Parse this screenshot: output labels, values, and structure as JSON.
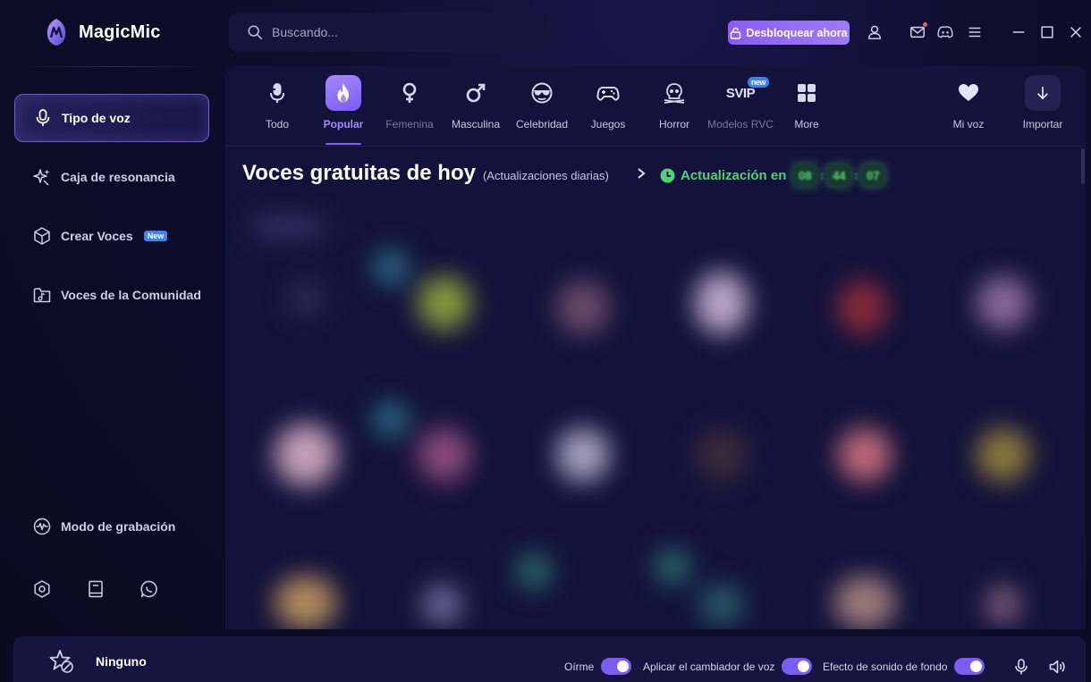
{
  "app": {
    "title": "MagicMic"
  },
  "search": {
    "placeholder": "Buscando..."
  },
  "header": {
    "unlock_label": "Desbloquear ahora",
    "icons": [
      "user-icon",
      "mail-icon",
      "discord-icon",
      "menu-icon",
      "minimize-icon",
      "maximize-icon",
      "close-icon"
    ]
  },
  "sidebar": {
    "items": [
      {
        "label": "Tipo de voz",
        "icon": "microphone-icon",
        "active": true
      },
      {
        "label": "Caja de resonancia",
        "icon": "sparkle-icon"
      },
      {
        "label": "Crear Voces",
        "icon": "cube-icon",
        "badge": "New"
      },
      {
        "label": "Voces de la Comunidad",
        "icon": "music-folder-icon"
      }
    ],
    "recording_mode": "Modo de grabación",
    "bottom_icons": [
      "settings-icon",
      "book-icon",
      "chat-icon"
    ]
  },
  "categories": [
    {
      "label": "Todo",
      "icon": "microphone-icon"
    },
    {
      "label": "Popular",
      "icon": "fire-icon",
      "active": true
    },
    {
      "label": "Femenina",
      "icon": "female-icon"
    },
    {
      "label": "Masculina",
      "icon": "male-icon"
    },
    {
      "label": "Celebridad",
      "icon": "sunglasses-icon"
    },
    {
      "label": "Juegos",
      "icon": "gamepad-icon"
    },
    {
      "label": "Horror",
      "icon": "skull-icon"
    },
    {
      "label": "Modelos RVC",
      "icon": "svip-icon",
      "text": "SVIP",
      "badge": "new"
    },
    {
      "label": "More",
      "icon": "grid-icon"
    },
    {
      "label": "Mi voz",
      "icon": "heart-icon"
    },
    {
      "label": "Importar",
      "icon": "download-icon"
    }
  ],
  "section": {
    "title": "Voces gratuitas de hoy",
    "subtitle": "(Actualizaciones diarias)",
    "update_label": "Actualización en",
    "timer": [
      "08",
      "44",
      "07"
    ]
  },
  "footer": {
    "current_voice": "Ninguno",
    "toggles": [
      {
        "label": "Oírme",
        "on": true
      },
      {
        "label": "Aplicar el cambiador de voz",
        "on": true
      },
      {
        "label": "Efecto de sonido de fondo",
        "on": true
      }
    ]
  },
  "colors": {
    "accent": "#8b5cf6",
    "background": "#0d0c26",
    "panel": "#13123a",
    "timer_green": "#4fd27a"
  }
}
